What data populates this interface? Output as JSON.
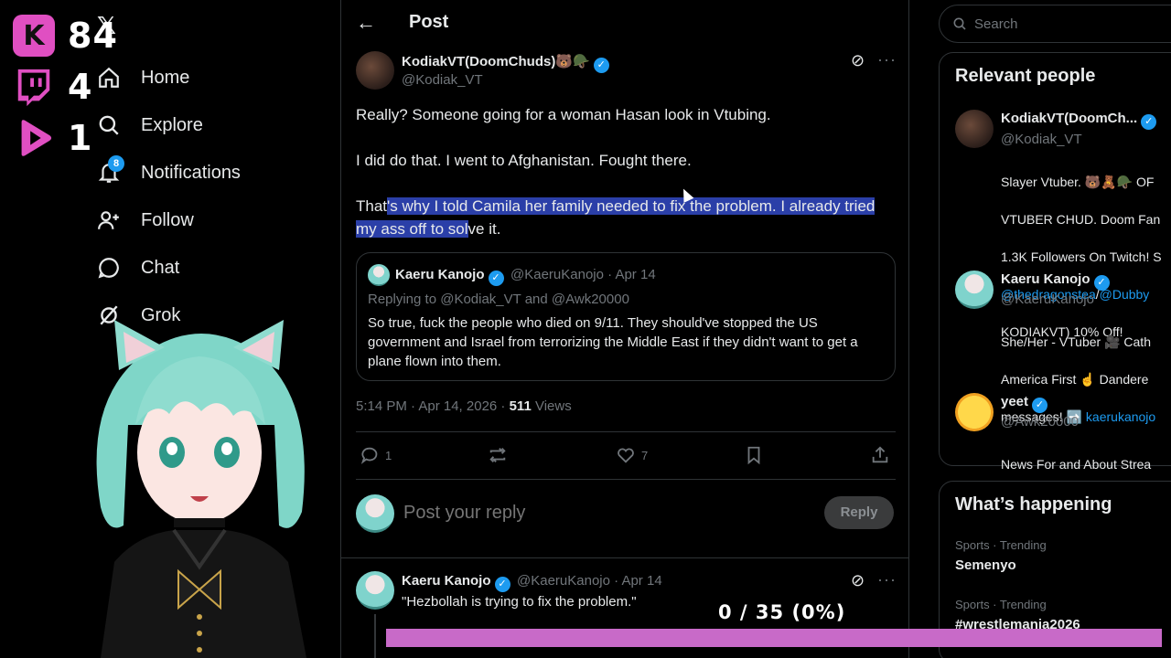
{
  "overlay_counters": {
    "kick": "84",
    "twitch": "4",
    "kick_play": "1"
  },
  "colors": {
    "accent": "#1d9bf0",
    "background": "#000000",
    "selection": "#2b3fa8",
    "overlay_pink": "#e04fc2",
    "progress_bar": "#c86ac8"
  },
  "nav": {
    "logo_icon": "x-logo-icon",
    "notifications_badge": "8",
    "items": [
      {
        "label": "Home",
        "icon": "home-icon"
      },
      {
        "label": "Explore",
        "icon": "search-icon"
      },
      {
        "label": "Notifications",
        "icon": "bell-icon"
      },
      {
        "label": "Follow",
        "icon": "follow-icon"
      },
      {
        "label": "Chat",
        "icon": "chat-icon"
      },
      {
        "label": "Grok",
        "icon": "grok-icon"
      }
    ]
  },
  "header": {
    "title": "Post"
  },
  "post": {
    "author_name": "KodiakVT(DoomChuds)🐻🪖",
    "author_handle": "@Kodiak_VT",
    "paragraph1": "Really?  Someone going for a woman Hasan look in Vtubing.",
    "paragraph2": "I did do that.  I went to Afghanistan.  Fought there.",
    "paragraph3_plain": "That",
    "paragraph3_selected": "'s why I told Camila her family needed to fix the problem.  I already tried my ass off to sol",
    "paragraph3_tail": "ve it.",
    "timestamp": "5:14 PM · Apr 14, 2026 · ",
    "views_count": "511",
    "views_label": " Views",
    "replies": "1",
    "likes": "7"
  },
  "quote": {
    "author_name": "Kaeru Kanojo",
    "author_handle": "@KaeruKanojo · Apr 14",
    "replying_to": "Replying to @Kodiak_VT and @Awk20000",
    "text": "So true, fuck the people who died on 9/11. They should've stopped the US government and Israel from terrorizing the Middle East if they didn't want to get a plane flown into them."
  },
  "reply_box": {
    "placeholder": "Post your reply",
    "button": "Reply"
  },
  "reply": {
    "author_name": "Kaeru Kanojo",
    "author_handle": "@KaeruKanojo · Apr 14",
    "text": "\"Hezbollah is trying to fix the problem.\""
  },
  "search": {
    "placeholder": "Search"
  },
  "relevant_people": {
    "title": "Relevant people",
    "people": [
      {
        "name": "KodiakVT(DoomCh...",
        "handle": "@Kodiak_VT",
        "bio_lines": [
          "Slayer Vtuber. 🐻🧸🪖 OF",
          "VTUBER CHUD. Doom Fan",
          "1.3K Followers On Twitch! S"
        ],
        "bio_links": [
          "@thedragonstea",
          "/",
          "@Dubby"
        ],
        "bio_last": "KODIAKVT) 10% Off!"
      },
      {
        "name": "Kaeru Kanojo",
        "handle": "@KaeruKanojo",
        "bio_lines": [
          "She/Her - VTuber 🎥 Cath",
          "America First ☝️ Dandere"
        ],
        "bio_tail": "messages! ➡️ ",
        "bio_link": "kaerukanojo"
      },
      {
        "name": "yeet",
        "handle": "@Awk20000",
        "bio_lines": [
          "News For and About Strea"
        ]
      }
    ]
  },
  "whats_happening": {
    "title": "What’s happening",
    "trends": [
      {
        "meta": "Sports · Trending",
        "name": "Semenyo"
      },
      {
        "meta": "Sports · Trending",
        "name": "#wrestlemania2026"
      }
    ]
  },
  "progress": {
    "label": "0 / 35 (0%)",
    "fraction": 0
  }
}
